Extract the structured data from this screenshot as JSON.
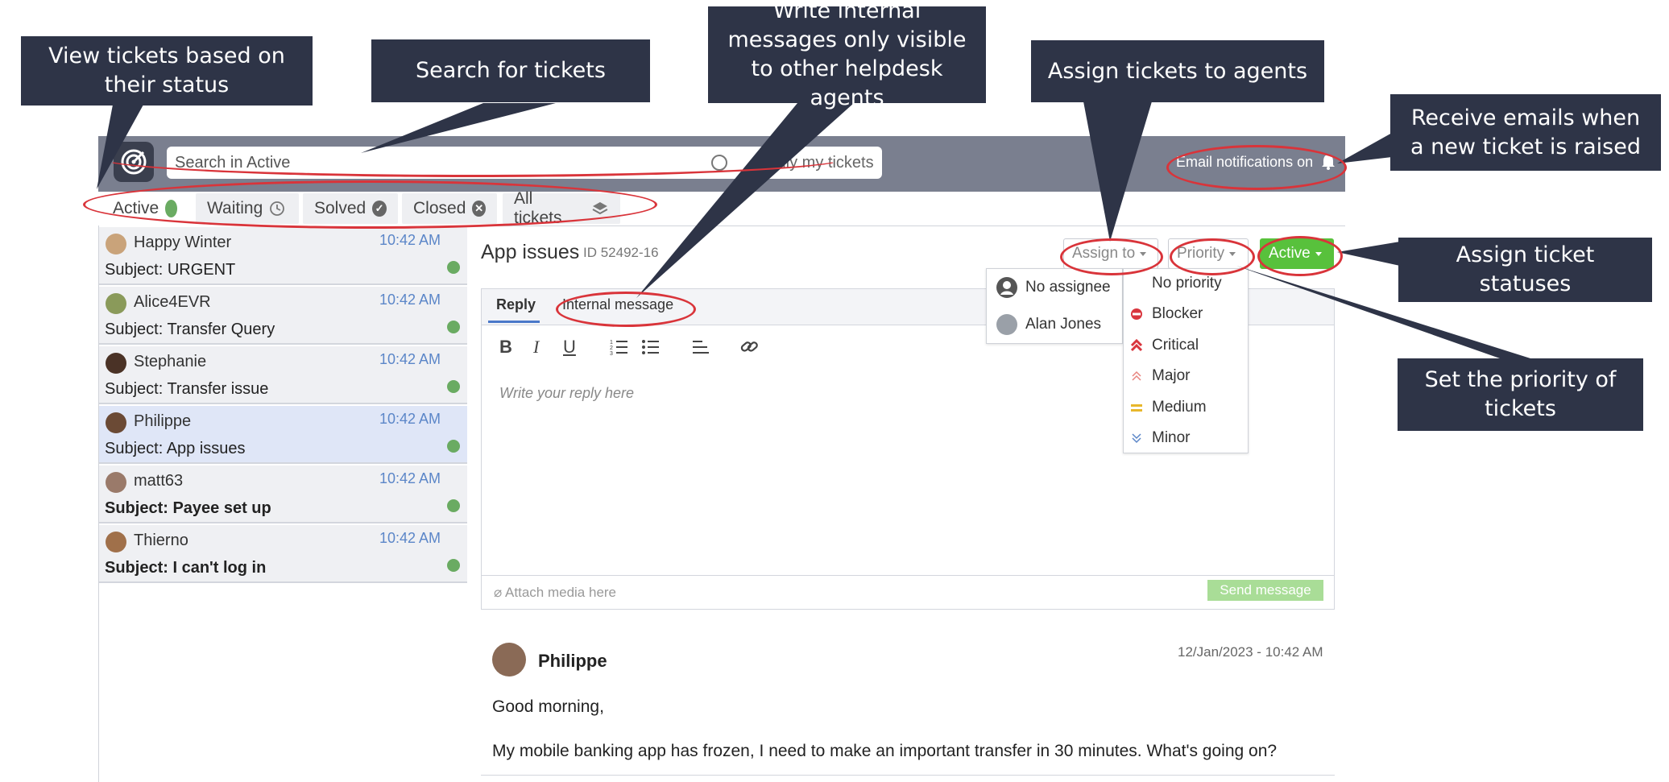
{
  "callouts": {
    "status": "View tickets based on their status",
    "search": "Search for tickets",
    "internal": "Write internal messages only visible to other helpdesk agents",
    "assign": "Assign tickets to agents",
    "emails": "Receive emails when a new ticket is raised",
    "statuses": "Assign ticket statuses",
    "priority": "Set the priority of tickets"
  },
  "topbar": {
    "search_placeholder": "Search in Active",
    "only_my_tickets": "Only my tickets",
    "email_notifications": "Email notifications on"
  },
  "tabs": [
    {
      "label": "Active",
      "icon": "green-dot"
    },
    {
      "label": "Waiting",
      "icon": "clock-icon"
    },
    {
      "label": "Solved",
      "icon": "check-circle-icon"
    },
    {
      "label": "Closed",
      "icon": "x-circle-icon"
    },
    {
      "label": "All tickets",
      "icon": "layers-icon"
    }
  ],
  "tickets": [
    {
      "name": "Happy Winter",
      "time": "10:42 AM",
      "subject": "Subject: URGENT",
      "unread": false,
      "selected": false
    },
    {
      "name": "Alice4EVR",
      "time": "10:42 AM",
      "subject": "Subject: Transfer Query",
      "unread": false,
      "selected": false
    },
    {
      "name": "Stephanie",
      "time": "10:42 AM",
      "subject": "Subject: Transfer issue",
      "unread": false,
      "selected": false
    },
    {
      "name": "Philippe",
      "time": "10:42 AM",
      "subject": "Subject: App issues",
      "unread": false,
      "selected": true
    },
    {
      "name": "matt63",
      "time": "10:42 AM",
      "subject": "Subject: Payee set up",
      "unread": true,
      "selected": false
    },
    {
      "name": "Thierno",
      "time": "10:42 AM",
      "subject": "Subject: I can't log in",
      "unread": true,
      "selected": false
    }
  ],
  "ticket": {
    "title": "App issues",
    "id": "ID 52492-16",
    "assign_label": "Assign to",
    "priority_label": "Priority",
    "status_label": "Active"
  },
  "editor": {
    "tab_reply": "Reply",
    "tab_internal": "Internal message",
    "placeholder": "Write your reply here",
    "attach": "Attach media here",
    "send": "Send message"
  },
  "assign_menu": [
    "No assignee",
    "Alan Jones"
  ],
  "priority_menu": [
    {
      "label": "No priority",
      "icon": "none",
      "color": ""
    },
    {
      "label": "Blocker",
      "icon": "blocker-icon",
      "color": "#d9363e"
    },
    {
      "label": "Critical",
      "icon": "double-chevron-up-icon",
      "color": "#d9363e"
    },
    {
      "label": "Major",
      "icon": "chevron-up-icon",
      "color": "#e8847f"
    },
    {
      "label": "Medium",
      "icon": "equals-icon",
      "color": "#e8b72c"
    },
    {
      "label": "Minor",
      "icon": "double-chevron-down-icon",
      "color": "#5b86c8"
    }
  ],
  "message": {
    "author": "Philippe",
    "date": "12/Jan/2023 - 10:42 AM",
    "line1": "Good morning,",
    "line2": "My mobile banking app has frozen, I need to make an important transfer in 30 minutes. What's going on?"
  },
  "colors": {
    "accent_green": "#58c13c",
    "annotation_red": "#d9343a",
    "callout_bg": "#2e3447"
  }
}
